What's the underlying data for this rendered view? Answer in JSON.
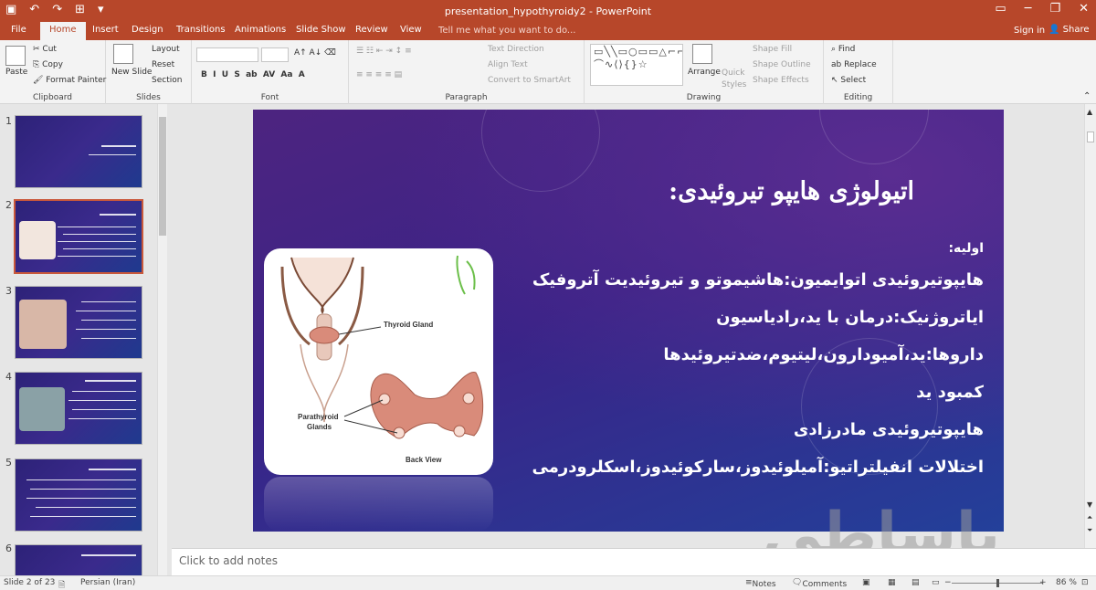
{
  "window": {
    "title": "presentation_hypothyroidy2 - PowerPoint",
    "sign_in": "Sign in",
    "share": "Share",
    "tell_me": "Tell me what you want to do..."
  },
  "tabs": [
    "File",
    "Home",
    "Insert",
    "Design",
    "Transitions",
    "Animations",
    "Slide Show",
    "Review",
    "View"
  ],
  "ribbon": {
    "clipboard": {
      "label": "Clipboard",
      "paste": "Paste",
      "cut": "Cut",
      "copy": "Copy",
      "format_painter": "Format Painter"
    },
    "slides": {
      "label": "Slides",
      "new_slide": "New Slide",
      "layout": "Layout",
      "reset": "Reset",
      "section": "Section"
    },
    "font": {
      "label": "Font"
    },
    "paragraph": {
      "label": "Paragraph",
      "text_direction": "Text Direction",
      "align_text": "Align Text",
      "convert_smartart": "Convert to SmartArt"
    },
    "drawing": {
      "label": "Drawing",
      "arrange": "Arrange",
      "quick_styles": "Quick Styles",
      "shape_fill": "Shape Fill",
      "shape_outline": "Shape Outline",
      "shape_effects": "Shape Effects"
    },
    "editing": {
      "label": "Editing",
      "find": "Find",
      "replace": "Replace",
      "select": "Select"
    }
  },
  "thumbnails": [
    "1",
    "2",
    "3",
    "4",
    "5",
    "6"
  ],
  "slide": {
    "title": "اتیولوژی هایپو تیروئیدی:",
    "subtitle": "اولیه:",
    "lines": [
      "هایپوتیروئیدی اتوایمیون:هاشیموتو و تیروئیدیت آتروفیک",
      "ایاتروژنیک:درمان با ید،رادیاسیون",
      "داروها:ید،آمیودارون،لیتیوم،ضدتیروئیدها",
      "کمبود ید",
      "هایپوتیروئیدی مادرزادی",
      "اختلالات انفیلتراتیو:آمیلوئیدوز،سارکوئیدوز،اسکلرودرمی"
    ],
    "image_labels": {
      "thyroid": "Thyroid Gland",
      "parathyroid_1": "Parathyroid",
      "parathyroid_2": "Glands",
      "back_view": "Back View"
    }
  },
  "notes_placeholder": "Click to add notes",
  "watermark": "باساطی",
  "status": {
    "slide_info": "Slide 2 of 23",
    "language": "Persian (Iran)",
    "notes": "Notes",
    "comments": "Comments",
    "zoom": "86 %"
  }
}
